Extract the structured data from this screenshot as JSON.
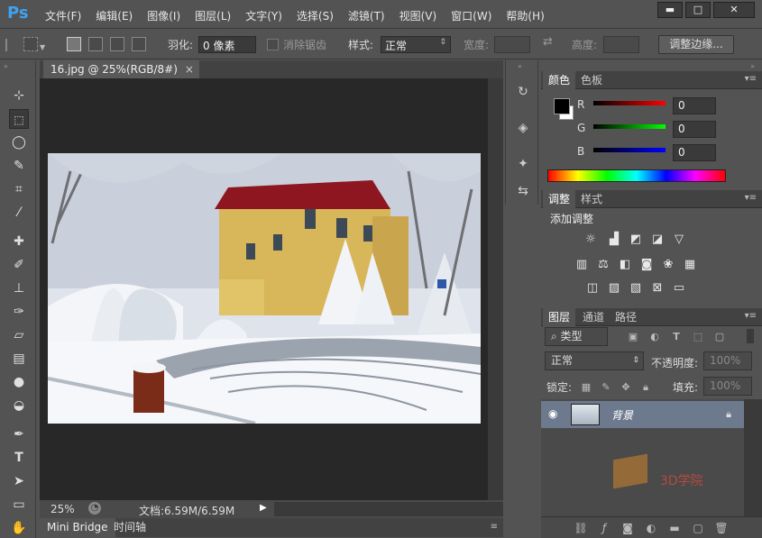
{
  "app": {
    "logo": "Ps"
  },
  "menu": [
    "文件(F)",
    "编辑(E)",
    "图像(I)",
    "图层(L)",
    "文字(Y)",
    "选择(S)",
    "滤镜(T)",
    "视图(V)",
    "窗口(W)",
    "帮助(H)"
  ],
  "window_controls": {
    "minimize": "▬",
    "maximize": "□",
    "close": "✕"
  },
  "options": {
    "feather_label": "羽化:",
    "feather_value": "0 像素",
    "antialias_label": "消除锯齿",
    "style_label": "样式:",
    "style_value": "正常",
    "width_label": "宽度:",
    "height_label": "高度:",
    "refine_button": "调整边缘..."
  },
  "document": {
    "tab_title": "16.jpg @ 25%(RGB/8#)",
    "tab_close": "×",
    "zoom": "25%",
    "doc_info": "文档:6.59M/6.59M"
  },
  "bottom_tabs": [
    "Mini Bridge",
    "时间轴"
  ],
  "color_panel": {
    "tabs": [
      "颜色",
      "色板"
    ],
    "channels": [
      {
        "label": "R",
        "value": "0"
      },
      {
        "label": "G",
        "value": "0"
      },
      {
        "label": "B",
        "value": "0"
      }
    ],
    "foreground": "#000000",
    "background": "#ffffff"
  },
  "adjust_panel": {
    "tabs": [
      "调整",
      "样式"
    ],
    "title": "添加调整"
  },
  "layers_panel": {
    "tabs": [
      "图层",
      "通道",
      "路径"
    ],
    "filter_kind": "类型",
    "blend_mode": "正常",
    "opacity_label": "不透明度:",
    "opacity_value": "100%",
    "lock_label": "锁定:",
    "fill_label": "填充:",
    "fill_value": "100%",
    "layer_name": "背景"
  },
  "watermark": "3D学院"
}
